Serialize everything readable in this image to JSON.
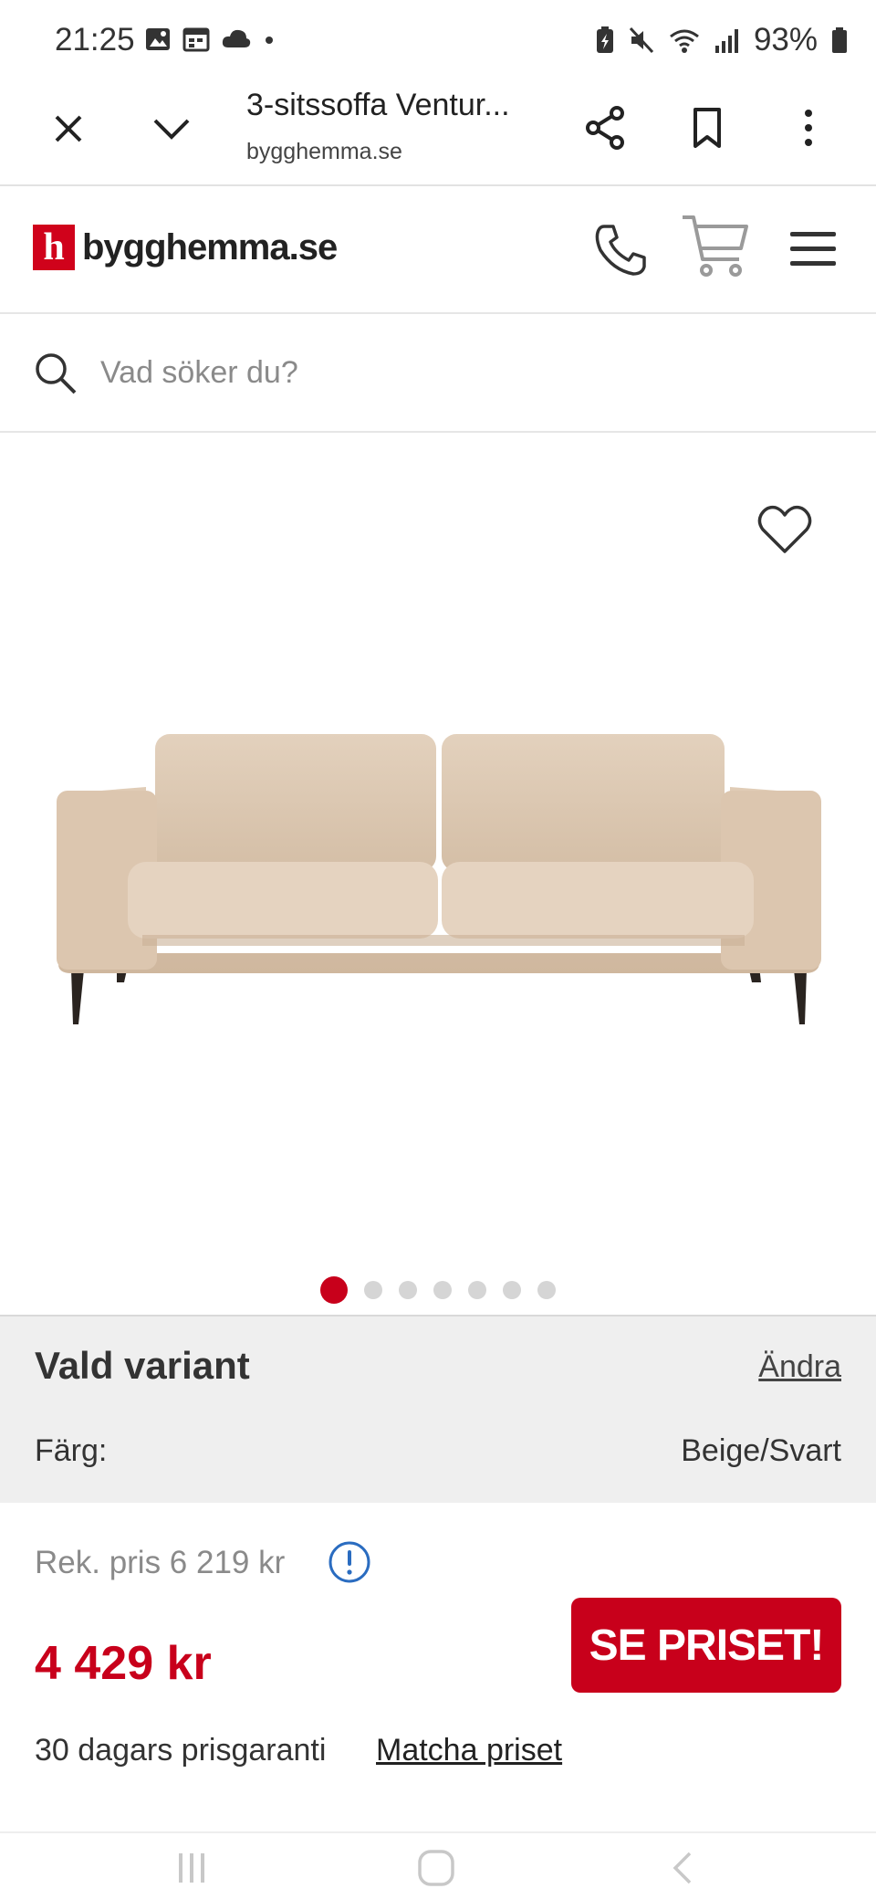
{
  "status_bar": {
    "time": "21:25",
    "battery": "93%",
    "left_icons": [
      "image-icon",
      "calendar-icon",
      "cloud-icon",
      "dot-icon"
    ],
    "right_icons": [
      "battery-saver-icon",
      "mute-icon",
      "wifi-icon",
      "signal-icon",
      "battery-icon"
    ]
  },
  "browser": {
    "page_title": "3-sitssoffa Ventur...",
    "domain": "bygghemma.se"
  },
  "site": {
    "logo_letter": "h",
    "logo_text": "bygghemma.se"
  },
  "search": {
    "placeholder": "Vad söker du?"
  },
  "gallery": {
    "image_alt": "3-sitssoffa beige",
    "total_images": 7,
    "active_index": 0
  },
  "variant": {
    "title": "Vald variant",
    "change_label": "Ändra",
    "color_label": "Färg:",
    "color_value": "Beige/Svart"
  },
  "price": {
    "recommended": "Rek. pris 6 219 kr",
    "current": "4 429 kr",
    "cta_label": "SE PRISET!",
    "guarantee": "30 dagars prisgaranti",
    "match_label": "Matcha priset"
  },
  "colors": {
    "brand_red": "#c8001b",
    "sofa_beige": "#dcc8b3"
  }
}
